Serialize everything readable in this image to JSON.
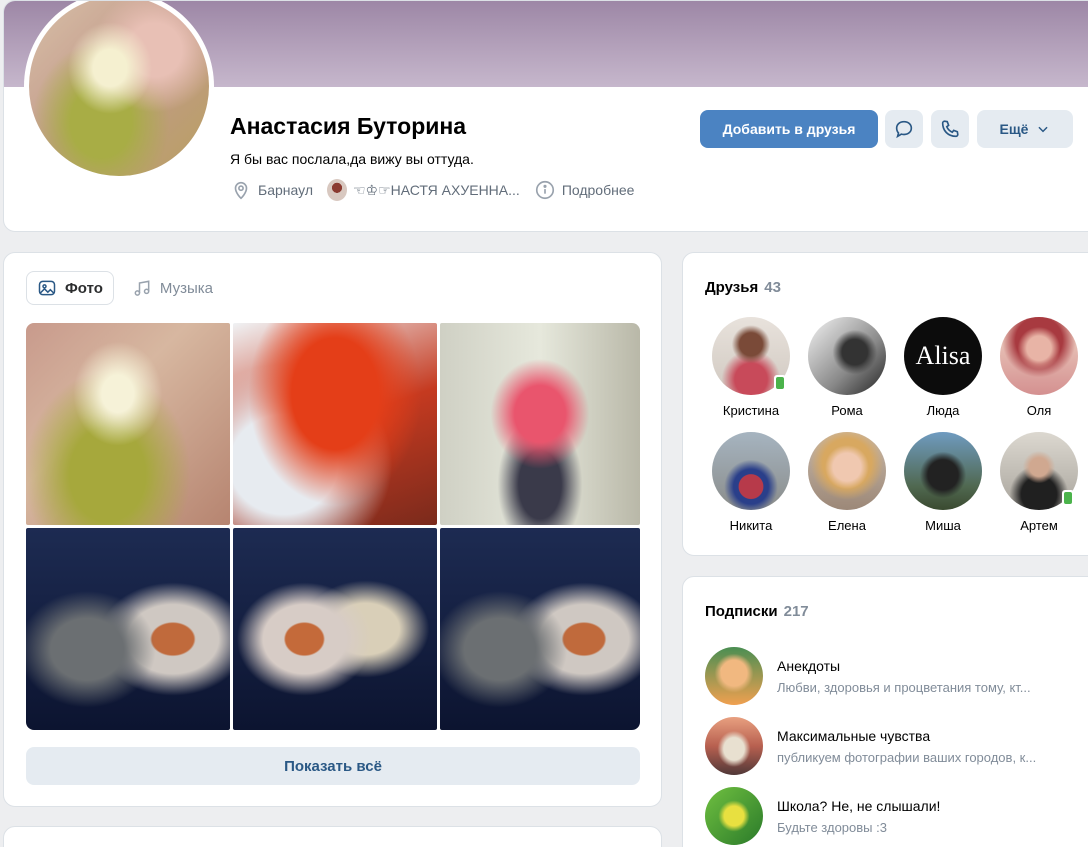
{
  "profile": {
    "name": "Анастасия Буторина",
    "status": "Я бы вас послала,да вижу вы оттуда.",
    "city": "Барнаул",
    "community": "☜♔☞НАСТЯ АХУЕННА...",
    "details": "Подробнее"
  },
  "actions": {
    "add_friend": "Добавить в друзья",
    "more": "Ещё"
  },
  "photos": {
    "tabs": [
      {
        "label": "Фото",
        "icon": "photo-icon",
        "active": true
      },
      {
        "label": "Музыка",
        "icon": "music-note-icon",
        "active": false
      }
    ],
    "show_all": "Показать всё"
  },
  "friends": {
    "title": "Друзья",
    "count": "43",
    "items": [
      {
        "name": "Кристина",
        "online": true
      },
      {
        "name": "Рома",
        "online": false
      },
      {
        "name": "Люда",
        "online": false,
        "avatar_text": "Alisa"
      },
      {
        "name": "Оля",
        "online": false
      },
      {
        "name": "Никита",
        "online": false
      },
      {
        "name": "Елена",
        "online": false
      },
      {
        "name": "Миша",
        "online": false
      },
      {
        "name": "Артем",
        "online": true
      }
    ]
  },
  "subscriptions": {
    "title": "Подписки",
    "count": "217",
    "items": [
      {
        "name": "Анекдоты",
        "desc": "Любви, здоровья и процветания тому, кт..."
      },
      {
        "name": "Максимальные чувства",
        "desc": "публикуем фотографии ваших городов, к..."
      },
      {
        "name": "Школа? Не, не слышали!",
        "desc": "Будьте здоровы :3"
      }
    ]
  },
  "colors": {
    "accent": "#4b83c2",
    "secondary_button": "#e5ebf1",
    "link": "#2a5885",
    "muted_text": "#818c99",
    "online": "#4bb34b"
  }
}
